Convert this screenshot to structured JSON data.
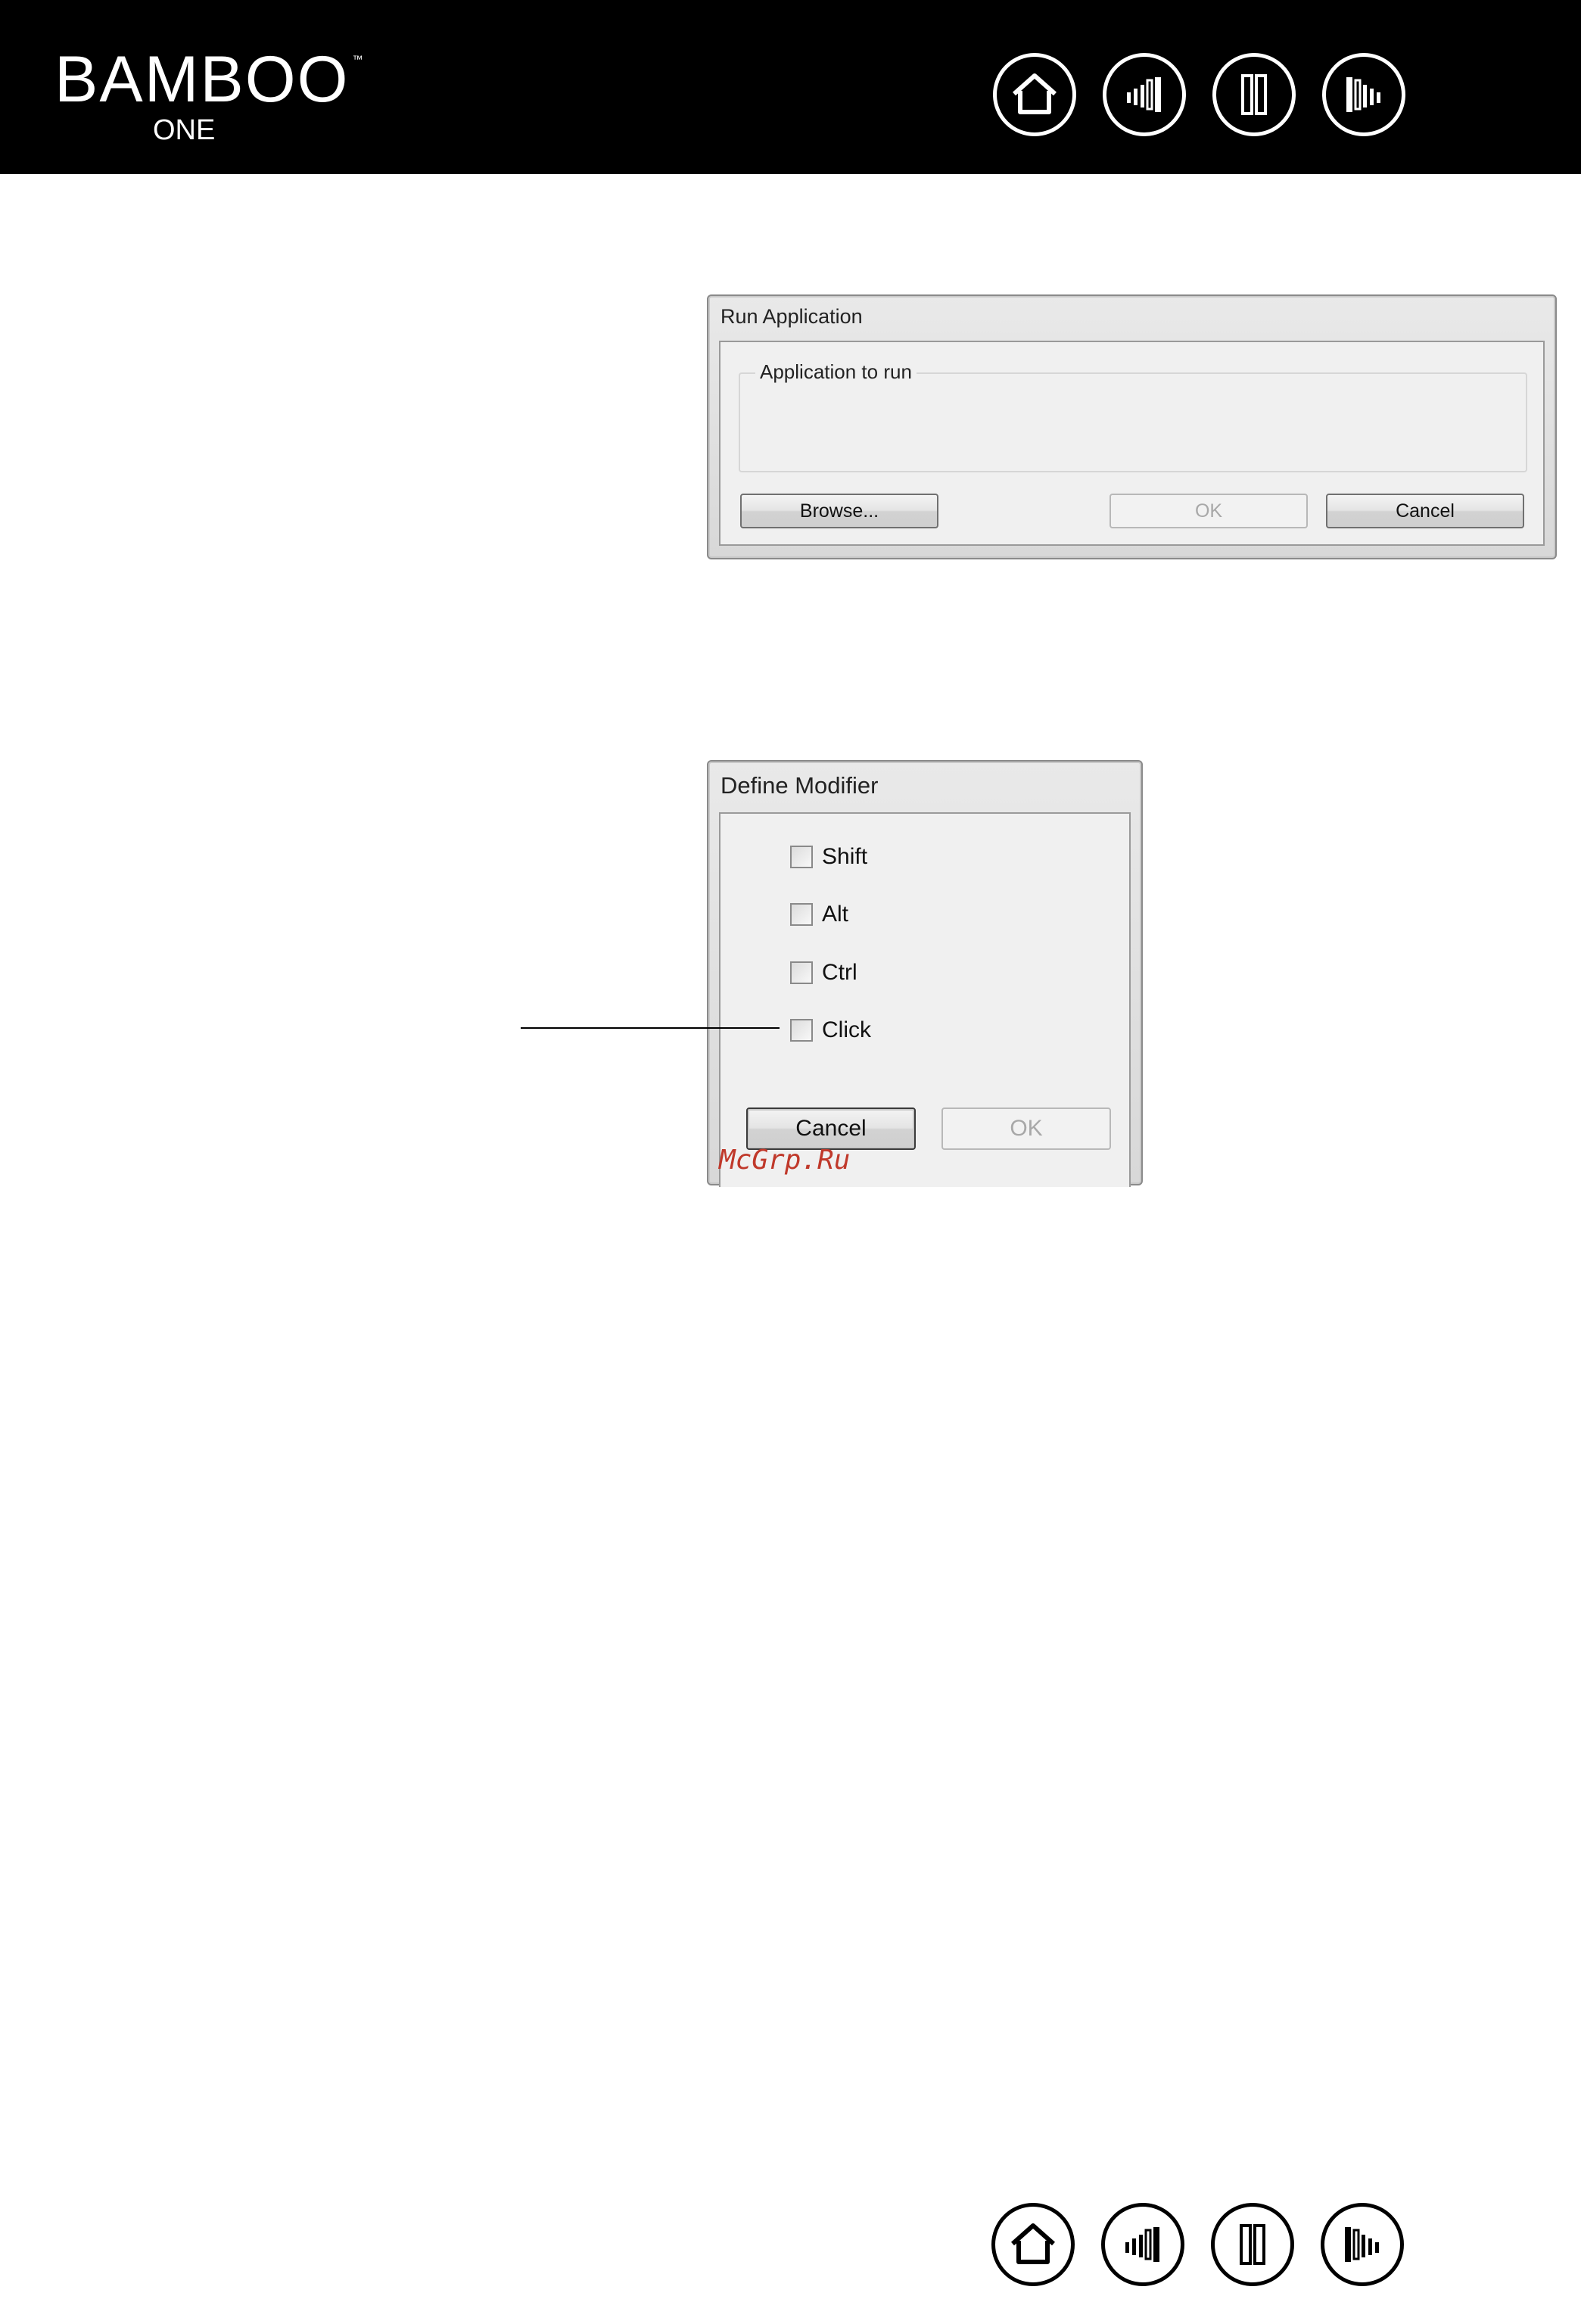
{
  "header": {
    "brand": "BAMBOO",
    "trademark": "™",
    "subtitle": "ONE"
  },
  "nav": {
    "icons": [
      "home-icon",
      "contents-icon",
      "index-icon",
      "next-icon"
    ]
  },
  "run_dialog": {
    "title": "Run Application",
    "group_label": "Application to run",
    "browse_label": "Browse...",
    "ok_label": "OK",
    "cancel_label": "Cancel"
  },
  "modifier_dialog": {
    "title": "Define Modifier",
    "options": [
      {
        "label": "Shift",
        "checked": false
      },
      {
        "label": "Alt",
        "checked": false
      },
      {
        "label": "Ctrl",
        "checked": false
      },
      {
        "label": "Click",
        "checked": false
      }
    ],
    "cancel_label": "Cancel",
    "ok_label": "OK"
  },
  "watermark": "McGrp.Ru",
  "colors": {
    "header_bg": "#000000",
    "watermark": "#c0392b"
  }
}
